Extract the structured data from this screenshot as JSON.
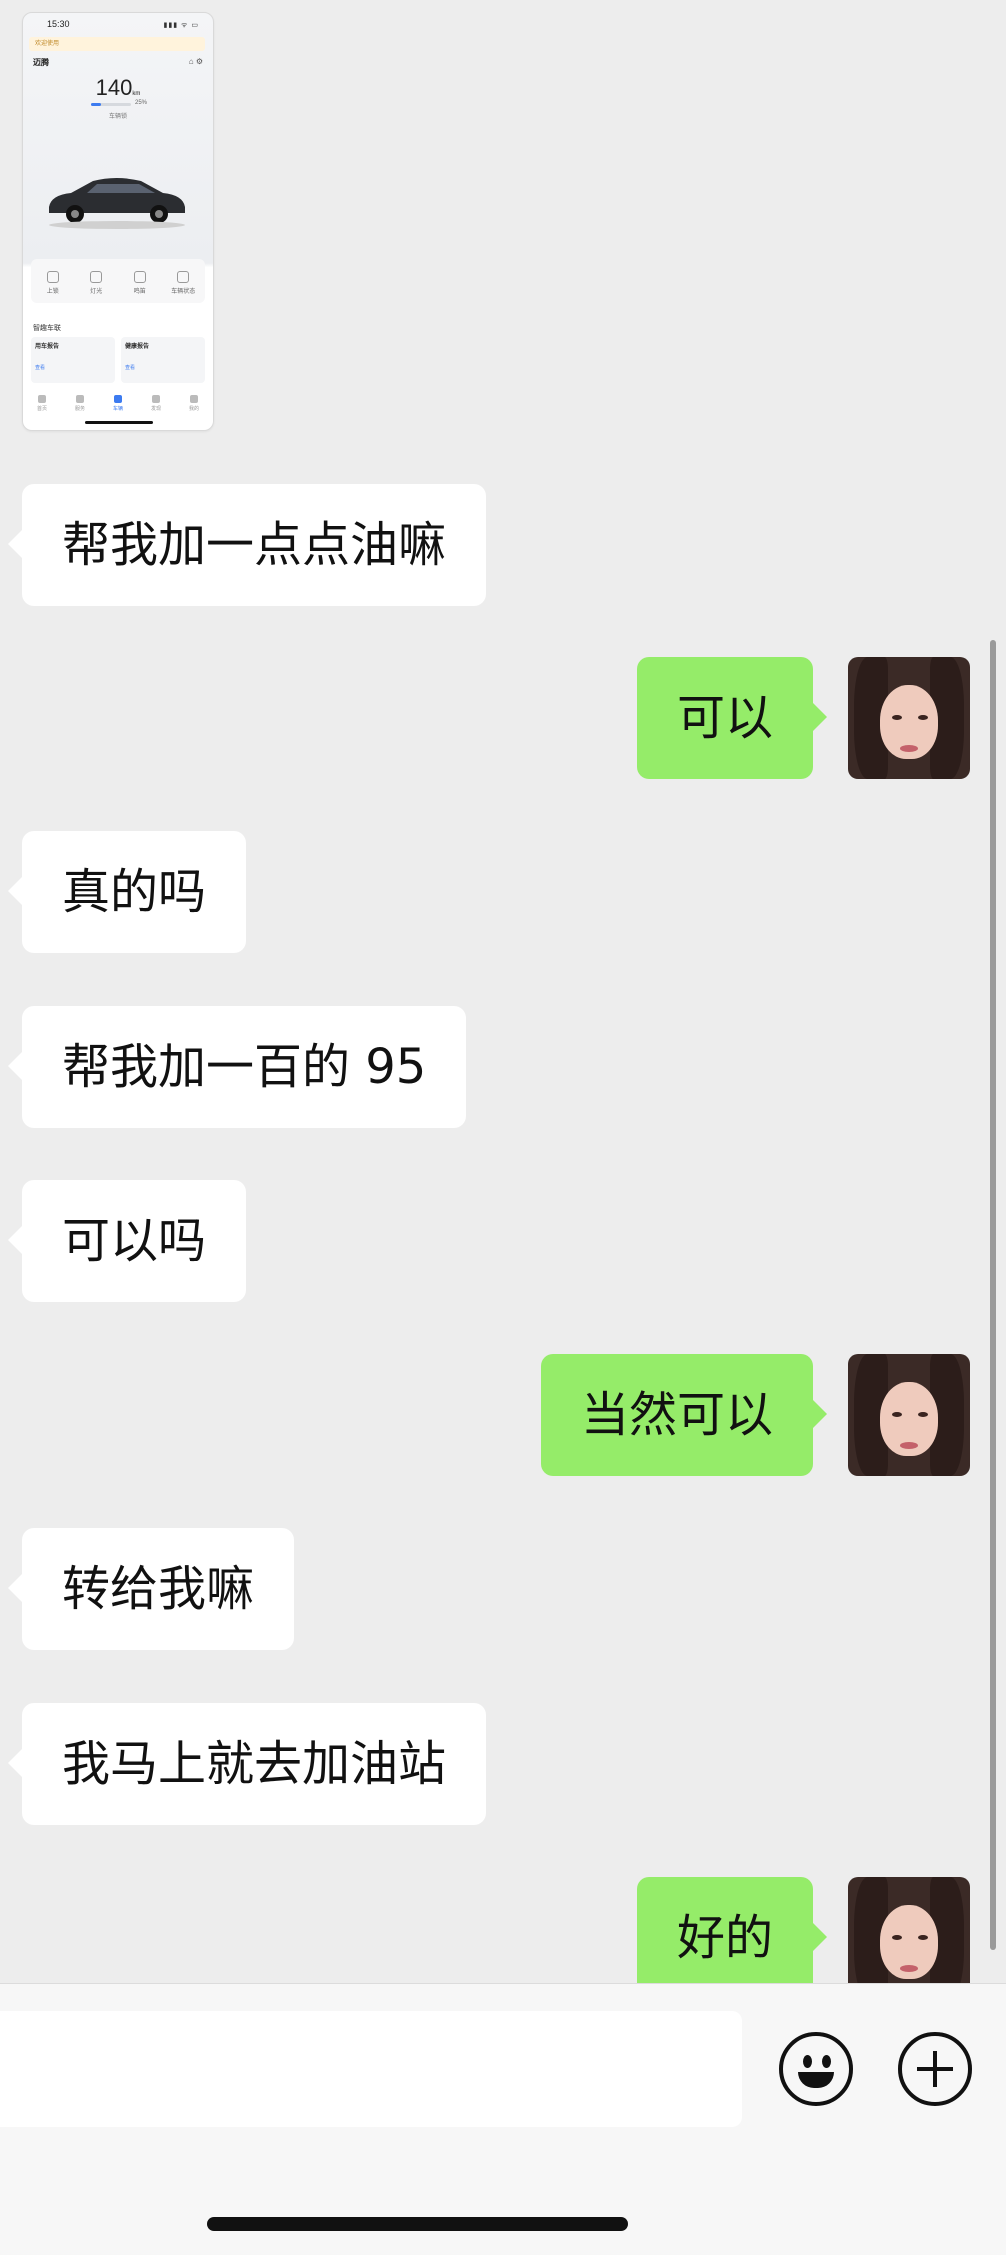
{
  "shared_screenshot": {
    "status_time": "15:30",
    "status_icons": "▮▮▮ ᯤ ▭",
    "banner": "欢迎使用",
    "car_name": "迈腾",
    "header_icons": "⌂ ⚙",
    "range_value": "140",
    "range_unit": "km",
    "fuel_level_pct": 25,
    "fuel_pct_text": "25%",
    "sub_text": "车辆锁",
    "controls": [
      "上锁",
      "灯光",
      "鸣笛",
      "车辆状态"
    ],
    "section_title": "智趣车联",
    "cards": [
      {
        "title": "用车报告",
        "detail": "查看"
      },
      {
        "title": "健康报告",
        "detail": "查看"
      }
    ],
    "tabs": [
      "首页",
      "服务",
      "车辆",
      "发现",
      "我的"
    ],
    "active_tab_index": 2
  },
  "messages": [
    {
      "side": "in",
      "text": "帮我加一点点油嘛"
    },
    {
      "side": "out",
      "text": "可以"
    },
    {
      "side": "in",
      "text": "真的吗"
    },
    {
      "side": "in",
      "text": "帮我加一百的 95"
    },
    {
      "side": "in",
      "text": "可以吗"
    },
    {
      "side": "out",
      "text": "当然可以"
    },
    {
      "side": "in",
      "text": "转给我嘛"
    },
    {
      "side": "in",
      "text": "我马上就去加油站"
    },
    {
      "side": "out",
      "text": "好的"
    }
  ],
  "input_bar": {
    "placeholder": "",
    "emoji_icon": "smiley-icon",
    "plus_icon": "plus-circle-icon"
  },
  "colors": {
    "background": "#ededed",
    "incoming_bubble": "#ffffff",
    "outgoing_bubble": "#95ec69",
    "input_bar": "#f7f7f7"
  }
}
